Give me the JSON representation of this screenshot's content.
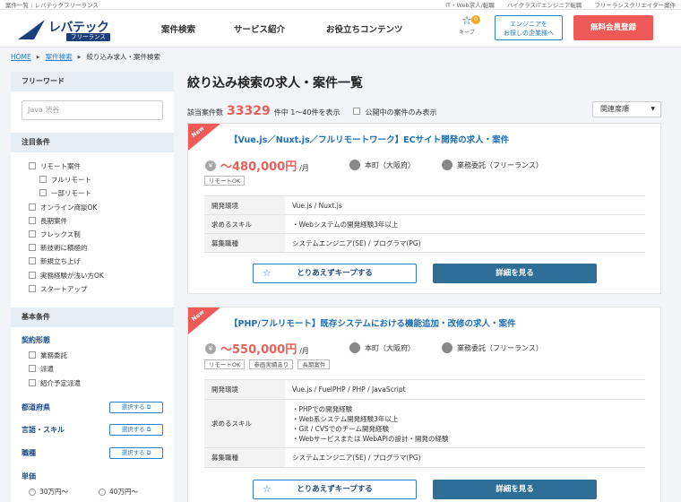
{
  "topbar": {
    "left": "案件一覧｜レバテックフリーランス",
    "links": [
      "IT・Web求人/転職",
      "ハイクラスITエンジニア転職",
      "フリーランスクリエイター案件"
    ]
  },
  "header": {
    "logo_name": "レバテック",
    "logo_sub": "フリーランス",
    "nav": [
      "案件検索",
      "サービス紹介",
      "お役立ちコンテンツ"
    ],
    "keep_label": "キープ",
    "keep_count": "0",
    "corp_button": [
      "エンジニアを",
      "お探しの企業様へ"
    ],
    "register_button": "無料会員登録"
  },
  "breadcrumb": {
    "home": "HOME",
    "search": "案件検索",
    "current": "絞り込み求人・案件検索"
  },
  "sidebar": {
    "free_word": {
      "title": "フリーワード",
      "placeholder": "Java 渋谷"
    },
    "featured": {
      "title": "注目条件",
      "items": [
        {
          "label": "リモート案件",
          "indent": 0
        },
        {
          "label": "フルリモート",
          "indent": 1
        },
        {
          "label": "一部リモート",
          "indent": 1
        },
        {
          "label": "オンライン商談OK",
          "indent": 0
        },
        {
          "label": "長期案件",
          "indent": 0
        },
        {
          "label": "フレックス制",
          "indent": 0
        },
        {
          "label": "新技術に積極的",
          "indent": 0
        },
        {
          "label": "新規立ち上げ",
          "indent": 0
        },
        {
          "label": "実務経験が浅い方OK",
          "indent": 0
        },
        {
          "label": "スタートアップ",
          "indent": 0
        }
      ]
    },
    "basic": {
      "title": "基本条件",
      "contract_title": "契約形態",
      "contract_items": [
        "業務委託",
        "派遣",
        "紹介予定派遣"
      ],
      "prefecture": "都道府県",
      "language_skill": "言語・スキル",
      "job_type": "職種",
      "select_label": "選択する",
      "unit_price": "単価",
      "price_options": [
        "30万円〜",
        "40万円〜"
      ]
    }
  },
  "main": {
    "title": "絞り込み検索の求人・案件一覧",
    "count_prefix": "該当案件数",
    "count": "33329",
    "count_suffix": "件中 1〜40件を表示",
    "open_only": "公開中の案件のみ表示",
    "sort": "関連度順",
    "new_label": "New",
    "keep_button": "とりあえずキープする",
    "detail_button": "詳細を見る",
    "jobs": [
      {
        "title": "【Vue.js／Nuxt.js／フルリモートワーク】ECサイト開発の求人・案件",
        "salary": "〜480,000円",
        "salary_unit": "/月",
        "location": "本町（大阪府）",
        "contract": "業務委託（フリーランス）",
        "tags": [
          "リモートOK"
        ],
        "spec": [
          {
            "key": "開発環境",
            "value": [
              "Vue.js / Nuxt.js"
            ]
          },
          {
            "key": "求めるスキル",
            "value": [
              "・Webシステムの開発経験3年以上"
            ]
          },
          {
            "key": "募集職種",
            "value": [
              "システムエンジニア(SE) / プログラマ(PG)"
            ]
          }
        ]
      },
      {
        "title": "【PHP/フルリモート】既存システムにおける機能追加・改修の求人・案件",
        "salary": "〜550,000円",
        "salary_unit": "/月",
        "location": "本町（大阪府）",
        "contract": "業務委託（フリーランス）",
        "tags": [
          "リモートOK",
          "参画実績あり",
          "長期案件"
        ],
        "spec": [
          {
            "key": "開発環境",
            "value": [
              "Vue.js / FuelPHP / PHP / JavaScript"
            ]
          },
          {
            "key": "求めるスキル",
            "value": [
              "・PHPでの開発経験",
              "・Web系システム開発経験3年以上",
              "・Git / CVSでのチーム開発経験",
              "・Webサービスまたは WebAPIの設計・開発の経験"
            ]
          },
          {
            "key": "募集職種",
            "value": [
              "システムエンジニア(SE) / プログラマ(PG)"
            ]
          }
        ]
      }
    ]
  },
  "colors": {
    "brand": "#1b3f7a",
    "accent_red": "#ee5a58",
    "link_blue": "#1d6eb5",
    "detail_button": "#2f6e96",
    "sidebar_head": "#e4eef4"
  }
}
